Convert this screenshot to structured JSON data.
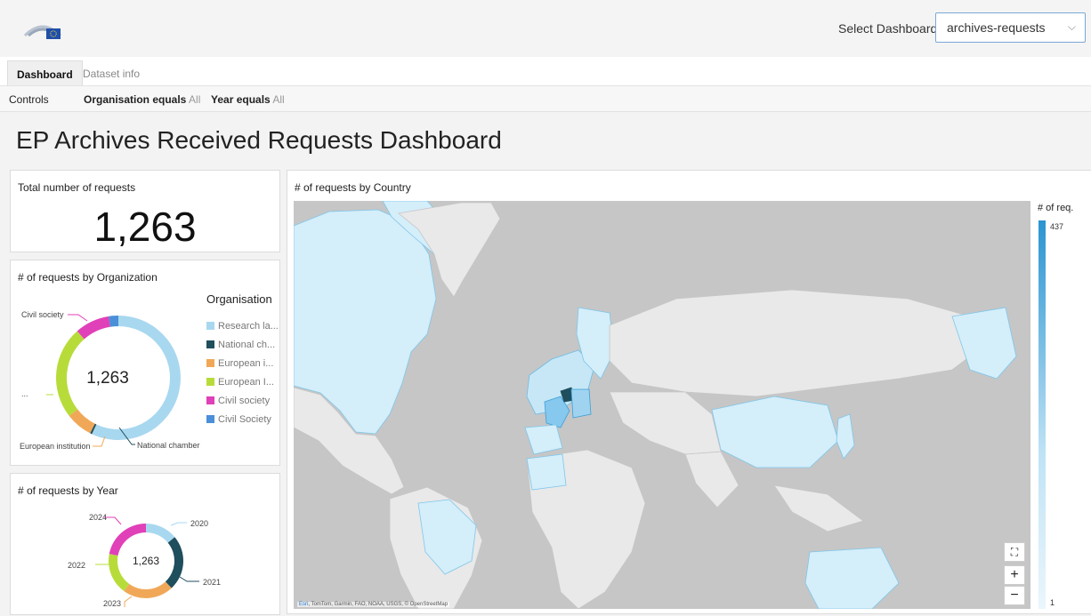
{
  "header": {
    "select_label": "Select Dashboard",
    "selected": "archives-requests"
  },
  "tabs": [
    {
      "label": "Dashboard"
    },
    {
      "label": "Dataset info"
    }
  ],
  "controls": {
    "label": "Controls",
    "org_label": "Organisation equals",
    "org_value": "All",
    "year_label": "Year equals",
    "year_value": "All"
  },
  "page_title": "EP Archives Received Requests Dashboard",
  "kpi": {
    "title": "Total number of requests",
    "value": "1,263"
  },
  "org_chart": {
    "title": "# of requests by Organization",
    "center": "1,263",
    "legend_title": "Organisation",
    "legend": [
      "Research la...",
      "National ch...",
      "European i...",
      "European I...",
      "Civil society",
      "Civil Society"
    ],
    "labels": {
      "civil": "Civil society",
      "dots": "...",
      "european": "European institution",
      "national": "National chamber"
    }
  },
  "year_chart": {
    "title": "# of requests by Year",
    "center": "1,263",
    "labels": [
      "2024",
      "2020",
      "2022",
      "2021",
      "2023"
    ]
  },
  "map": {
    "title": "# of requests by Country",
    "scale_title": "# of req.",
    "scale_max": "437",
    "scale_min": "1",
    "attribution_esri": "Esri",
    "attribution": ", TomTom, Garmin, FAO, NOAA, USGS, © OpenStreetMap"
  },
  "colors": {
    "research": "#a8d8ef",
    "national": "#1f4e5c",
    "european_i": "#f0a858",
    "european_I": "#b7dc3a",
    "civil": "#e040b8",
    "civil2": "#4a8fd8"
  },
  "chart_data": [
    {
      "type": "pie",
      "title": "# of requests by Organization",
      "categories": [
        "Research la...",
        "National ch...",
        "European i...",
        "European I...",
        "Civil society",
        "Civil Society"
      ],
      "values": [
        0.57,
        0.005,
        0.07,
        0.24,
        0.09,
        0.025
      ]
    },
    {
      "type": "pie",
      "title": "# of requests by Year",
      "categories": [
        "2020",
        "2021",
        "2023",
        "2022",
        "2024"
      ],
      "values": [
        0.14,
        0.24,
        0.22,
        0.18,
        0.22
      ]
    }
  ]
}
